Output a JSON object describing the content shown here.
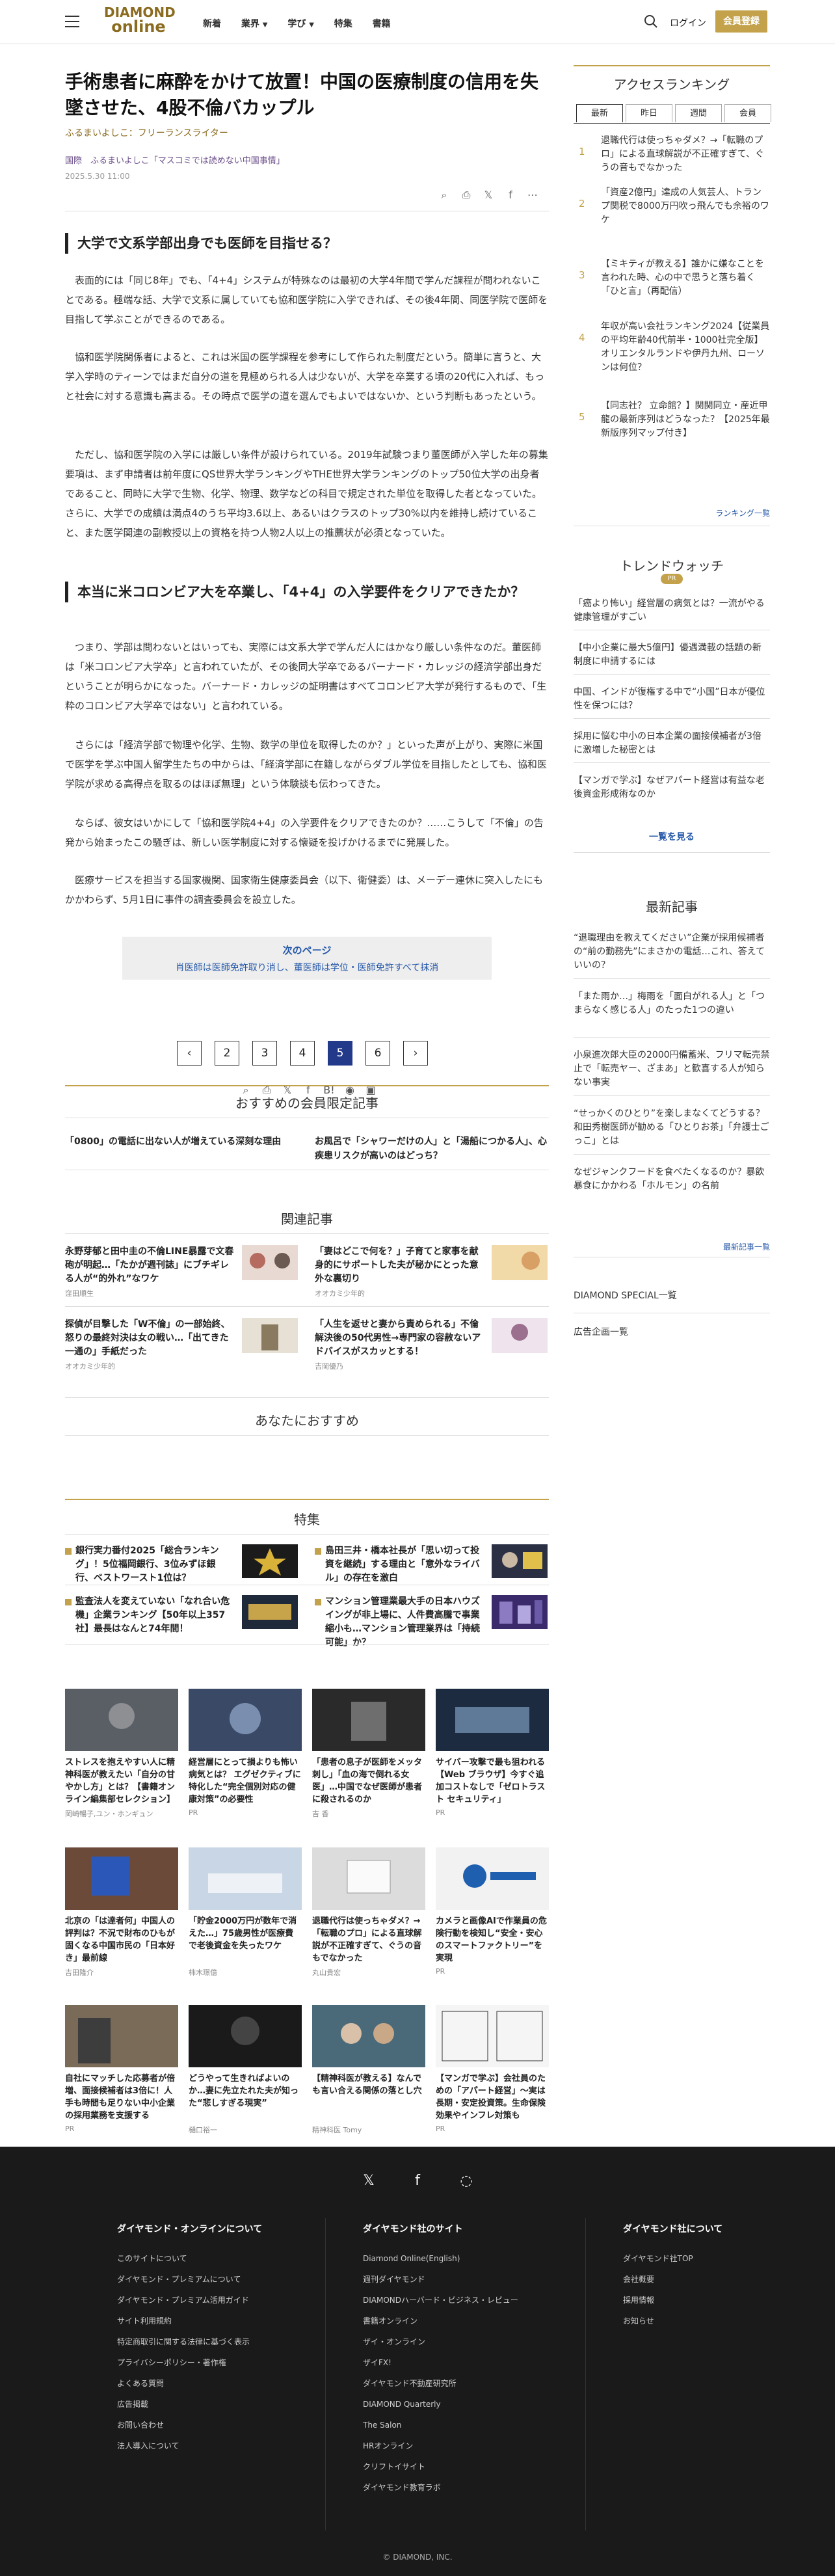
{
  "header": {
    "logo_top": "DIAMOND",
    "logo_bottom": "online",
    "nav": [
      "新着",
      "業界",
      "学び",
      "特集",
      "書籍"
    ],
    "login": "ログイン",
    "register": "会員登録"
  },
  "article": {
    "title": "手術患者に麻酔をかけて放置！中国の医療制度の信用を失墜させた、4股不倫バカップル",
    "author": "ふるまいよしこ：フリーランスライター",
    "series": "国際　ふるまいよしこ「マスコミでは読めない中国事情」",
    "date": "2025.5.30 11:00",
    "h_1": "大学で文系学部出身でも医師を目指せる？",
    "p_1": "表面的には「同じ8年」でも、「4+4」システムが特殊なのは最初の大学4年間で学んだ課程が問われないことである。極端な話、大学で文系に属していても協和医学院に入学できれば、その後4年間、同医学院で医師を目指して学ぶことができるのである。",
    "p_2": "協和医学院関係者によると、これは米国の医学課程を参考にして作られた制度だという。簡単に言うと、大学入学時のティーンではまだ自分の道を見極められる人は少ないが、大学を卒業する頃の20代に入れば、もっと社会に対する意識も高まる。その時点で医学の道を選んでもよいではないか、という判断もあったという。",
    "p_3": "ただし、協和医学院の入学には厳しい条件が設けられている。2019年試験つまり董医師が入学した年の募集要項は、まず申請者は前年度にQS世界大学ランキングやTHE世界大学ランキングのトップ50位大学の出身者であること、同時に大学で生物、化学、物理、数学などの科目で規定された単位を取得した者となっていた。さらに、大学での成績は満点4のうち平均3.6以上、あるいはクラスのトップ30%以内を維持し続けていること、また医学関連の副教授以上の資格を持つ人物2人以上の推薦状が必須となっていた。",
    "h_2": "本当に米コロンビア大を卒業し、「4+4」の入学要件をクリアできたか？",
    "p_4": "つまり、学部は問わないとはいっても、実際には文系大学で学んだ人にはかなり厳しい条件なのだ。董医師は「米コロンビア大学卒」と言われていたが、その後同大学卒であるバーナード・カレッジの経済学部出身だということが明らかになった。バーナード・カレッジの証明書はすべてコロンビア大学が発行するもので、「生粋のコロンビア大学卒ではない」と言われている。",
    "p_5": "さらには「経済学部で物理や化学、生物、数学の単位を取得したのか？」といった声が上がり、実際に米国で医学を学ぶ中国人留学生たちの中からは、「経済学部に在籍しながらダブル学位を目指したとしても、協和医学院が求める高得点を取るのはほぼ無理」という体験談も伝わってきた。",
    "p_6": "ならば、彼女はいかにして「協和医学院4+4」の入学要件をクリアできたのか？……こうして「不倫」の告発から始まったこの騒ぎは、新しい医学制度に対する懐疑を投げかけるまでに発展した。",
    "p_7": "医療サービスを担当する国家機関、国家衛生健康委員会（以下、衛健委）は、メーデー連休に突入したにもかかわらず、5月1日に事件の調査委員会を設立した。",
    "next_label": "次のページ",
    "next_title": "肖医師は医師免許取り消し、董医師は学位・医師免許すべて抹消",
    "pages": [
      "1",
      "2",
      "3",
      "4",
      "5",
      "6"
    ],
    "current_page": "5"
  },
  "recommend": {
    "heading": "おすすめの会員限定記事",
    "items": [
      "「0800」の電話に出ない人が増えている深刻な理由",
      "お風呂で「シャワーだけの人」と「湯船につかる人」、心疾患リスクが高いのはどっち？"
    ]
  },
  "related": {
    "heading": "関連記事",
    "items": [
      {
        "title": "永野芽郁と田中圭の不倫LINE暴露で文春砲が明起…「たかが週刊誌」にブチギレる人が“的外れ”なワケ",
        "src": "窪田順生"
      },
      {
        "title": "「妻はどこで何を？」子育てと家事を献身的にサポートした夫が秘かにとった意外な裏切り",
        "src": "オオカミ少年的"
      },
      {
        "title": "探偵が目撃した「W不倫」の一部始終、怒りの最終対決は女の戦い…「出てきた一通の」手紙だった",
        "src": "オオカミ少年的"
      },
      {
        "title": "「人生を返せと妻から責められる」不倫解決後の50代男性→専門家の容赦ないアドバイスがスカッとする！",
        "src": "吉岡優乃"
      }
    ]
  },
  "foryou": {
    "heading": "あなたにおすすめ"
  },
  "feature": {
    "heading": "特集",
    "items": [
      "銀行実力番付2025「総合ランキング」！5位福岡銀行、3位みずほ銀行、ベストワースト1位は？",
      "島田三井・橋本社長が「思い切って投資を継続」する理由と「意外なライバル」の存在を激白",
      "監査法人を変えていない「なれ合い危機」企業ランキング【50年以上357社】最長はなんと74年間！",
      "マンション管理業最大手の日本ハウズイングが非上場に、人件費高騰で事業縮小も…マンション管理業界は「持続可能」か？"
    ]
  },
  "cards": [
    {
      "title": "ストレスを抱えやすい人に精神科医が教えたい「自分の甘やかし方」とは？【書籍オンライン編集部セレクション】",
      "src": "岡崎暢子,ユン・ホンギュン"
    },
    {
      "title": "経営層にとって損よりも怖い病気とは？ エグゼクティブに特化した“完全個別対応の健康対策”の必要性",
      "src": "PR"
    },
    {
      "title": "「患者の息子が医師をメッタ刺し」「血の海で倒れる女医」…中国でなぜ医師が患者に殺されるのか",
      "src": "吉 香"
    },
    {
      "title": "サイバー攻撃で最も狙われる【Web ブラウザ】今すぐ追加コストなしで「ゼロトラスト セキュリティ」",
      "src": "PR"
    },
    {
      "title": "北京の「は達者何」中国人の評判は？不況で財布のひもが固くなる中国市民の「日本好き」最前線",
      "src": "吉田隆介"
    },
    {
      "title": "「貯金2000万円が数年で消えた…」75歳男性が医療費で老後資金を失ったワケ",
      "src": "柿木璟億"
    },
    {
      "title": "退職代行は使っちゃダメ？→「転職のプロ」による直球解説が不正確すぎて、ぐうの音もでなかった",
      "src": "丸山貴宏"
    },
    {
      "title": "カメラと画像AIで作業員の危険行動を検知し“安全・安心のスマートファクトリー”を実現",
      "src": "PR"
    },
    {
      "title": "自社にマッチした応募者が倍増、面接候補者は3倍に！人手も時間も足りない中小企業の採用業務を支援する",
      "src": "PR"
    },
    {
      "title": "どうやって生きればよいのか…妻に先立たれた夫が知った“悲しすぎる現実”",
      "src": "樋口裕一"
    },
    {
      "title": "【精神科医が教える】なんでも言い合える関係の落とし穴",
      "src": "精神科医 Tomy"
    },
    {
      "title": "【マンガで学ぶ】会社員のための「アパート経営」～実は長期・安定投資策。生命保険効果やインフレ対策も",
      "src": "PR"
    }
  ],
  "sidebar": {
    "ranking_title": "アクセスランキング",
    "tabs": [
      "最新",
      "昨日",
      "週間",
      "会員"
    ],
    "ranking": [
      {
        "n": "1",
        "t": "退職代行は使っちゃダメ？→「転職のプロ」による直球解説が不正確すぎて、ぐうの音もでなかった"
      },
      {
        "n": "2",
        "t": "「資産2億円」達成の人気芸人、トランプ関税で8000万円吹っ飛んでも余裕のワケ"
      },
      {
        "n": "3",
        "t": "【ミキティが教える】誰かに嫌なことを言われた時、心の中で思うと落ち着く「ひと言」（再配信）"
      },
      {
        "n": "4",
        "t": "年収が高い会社ランキング2024【従業員の平均年齢40代前半・1000社完全版】オリエンタルランドや伊丹九州、ローソンは何位？"
      },
      {
        "n": "5",
        "t": "【同志社？ 立命館？】関関同立・産近甲龍の最新序列はどうなった？【2025年最新版序列マップ付き】"
      }
    ],
    "ranking_more": "ランキング一覧",
    "trend_title": "トレンドウォッチ",
    "trend_badge": "PR",
    "trend": [
      "「癌より怖い」経営層の病気とは？一流がやる健康管理がすごい",
      "【中小企業に最大5億円】優遇満載の話題の新制度に申請するには",
      "中国、インドが復権する中で“小国”日本が優位性を保つには？",
      "採用に悩む中小の日本企業の面接候補者が3倍に激増した秘密とは",
      "【マンガで学ぶ】なぜアパート経営は有益な老後資金形成術なのか"
    ],
    "trend_more": "一覧を見る",
    "latest_title": "最新記事",
    "latest": [
      "“退職理由を教えてください”企業が採用候補者の“前の勤務先”にまさかの電話…これ、答えていいの？",
      "「また雨か…」梅雨を「面白がれる人」と「つまらなく感じる人」のたった1つの違い",
      "小泉進次郎大臣の2000円備蓄米、フリマ転売禁止で「転売ヤー、ざまあ」と歓喜する人が知らない事実",
      "“せっかくのひとり”を楽しまなくてどうする？和田秀樹医師が勧める「ひとりお茶」「弁護士ごっこ」とは",
      "なぜジャンクフードを食べたくなるのか？暴飲暴食にかかわる「ホルモン」の名前"
    ],
    "latest_more": "最新記事一覧",
    "special": "DIAMOND SPECIAL一覧",
    "ads": "広告企画一覧"
  },
  "footer": {
    "col1": {
      "h": "ダイヤモンド・オンラインについて",
      "items": [
        "このサイトについて",
        "ダイヤモンド・プレミアムについて",
        "ダイヤモンド・プレミアム活用ガイド",
        "サイト利用規約",
        "特定商取引に関する法律に基づく表示",
        "プライバシーポリシー・著作権",
        "よくある質問",
        "広告掲載",
        "お問い合わせ",
        "法人導入について"
      ]
    },
    "col2": {
      "h": "ダイヤモンド社のサイト",
      "items": [
        "Diamond Online(English)",
        "週刊ダイヤモンド",
        "DIAMONDハーバード・ビジネス・レビュー",
        "書籍オンライン",
        "ザイ・オンライン",
        "ザイFX!",
        "ダイヤモンド不動産研究所",
        "DIAMOND Quarterly",
        "The Salon",
        "HRオンライン",
        "クリフトイサイト",
        "ダイヤモンド教育ラボ"
      ]
    },
    "col3": {
      "h": "ダイヤモンド社について",
      "items": [
        "ダイヤモンド社TOP",
        "会社概要",
        "採用情報",
        "お知らせ"
      ]
    },
    "copyright": "© DIAMOND, INC."
  }
}
